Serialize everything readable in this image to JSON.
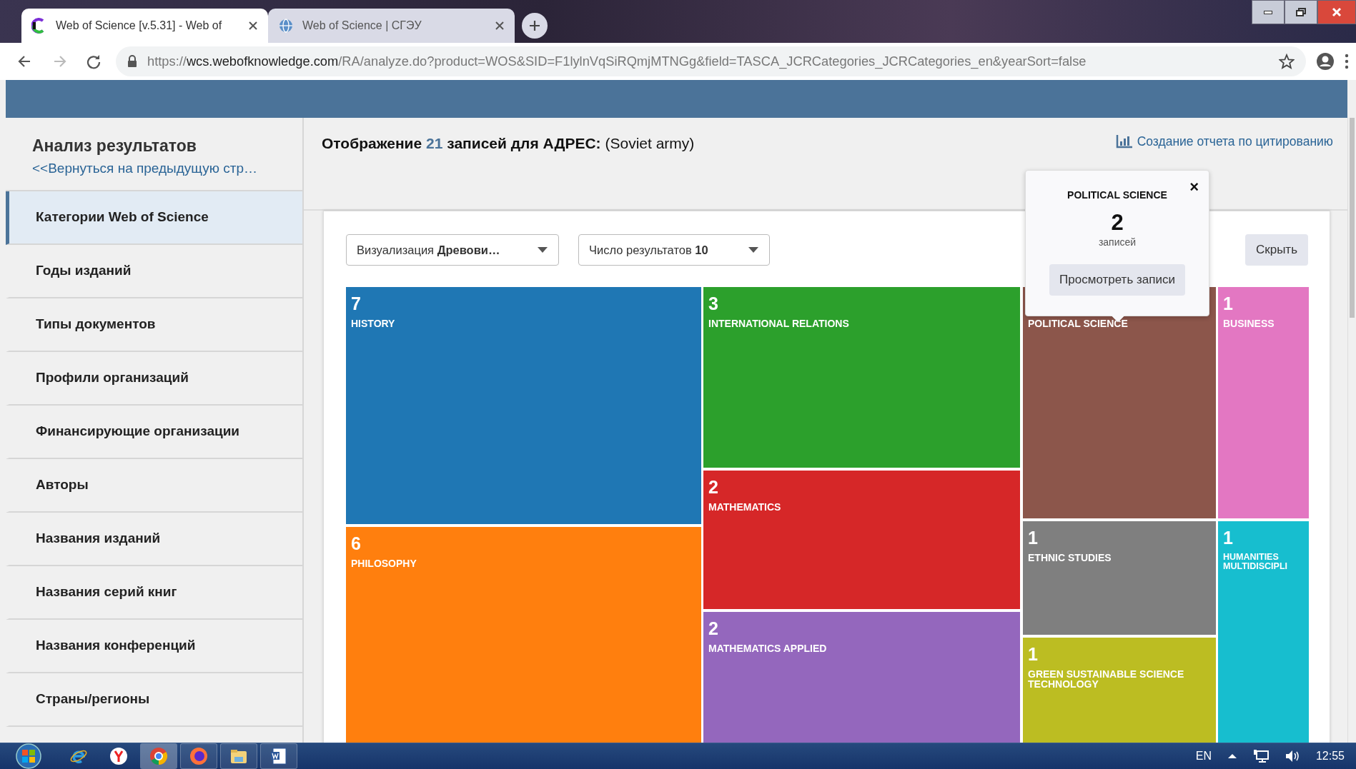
{
  "browser": {
    "tabs": [
      {
        "title": "Web of Science [v.5.31] - Web of",
        "kind": "logo",
        "selected": true
      },
      {
        "title": "Web of Science | СГЭУ",
        "kind": "globe",
        "selected": false
      }
    ],
    "nav": [
      {
        "kind": "back",
        "disabled": false
      },
      {
        "kind": "forward",
        "disabled": true
      },
      {
        "kind": "reload",
        "disabled": false
      }
    ],
    "url": {
      "scheme": "https://",
      "host": "wcs.webofknowledge.com",
      "path": "/RA/analyze.do?product=WOS&SID=F1lylnVqSiRQmjMTNGg&field=TASCA_JCRCategories_JCRCategories_en&yearSort=false"
    }
  },
  "sidebar": {
    "title": "Анализ результатов",
    "back_link": "<<Вернуться на предыдущую стр…",
    "items": [
      {
        "label": "Категории Web of Science",
        "selected": true
      },
      {
        "label": "Годы изданий",
        "selected": false
      },
      {
        "label": "Типы документов",
        "selected": false
      },
      {
        "label": "Профили организаций",
        "selected": false
      },
      {
        "label": "Финансирующие организации",
        "selected": false
      },
      {
        "label": "Авторы",
        "selected": false
      },
      {
        "label": "Названия изданий",
        "selected": false
      },
      {
        "label": "Названия серий книг",
        "selected": false
      },
      {
        "label": "Названия конференций",
        "selected": false
      },
      {
        "label": "Страны/регионы",
        "selected": false
      }
    ]
  },
  "header": {
    "prefix": "Отображение",
    "count": "21",
    "middle": "записей для АДРЕС:",
    "query": "(Soviet army)",
    "report_link": "Создание отчета по цитированию"
  },
  "controls": {
    "visualization": "Визуализация **Древови…**",
    "results": "Число результатов **10**",
    "hide_button": "Скрыть"
  },
  "treemap": {
    "cells": [
      {
        "count": "7",
        "label": "HISTORY",
        "color": "#1f77b4"
      },
      {
        "count": "6",
        "label": "PHILOSOPHY",
        "color": "#ff7f0e"
      },
      {
        "count": "3",
        "label": "INTERNATIONAL RELATIONS",
        "color": "#2ca02c"
      },
      {
        "count": "2",
        "label": "MATHEMATICS",
        "color": "#d62728"
      },
      {
        "count": "2",
        "label": "MATHEMATICS APPLIED",
        "color": "#9467bd"
      },
      {
        "label": "POLITICAL SCIENCE",
        "color": "#8c564b"
      },
      {
        "count": "1",
        "label": "ETHNIC STUDIES",
        "color": "#7f7f7f"
      },
      {
        "count": "1",
        "label": "GREEN SUSTAINABLE SCIENCE TECHNOLOGY",
        "color": "#bcbd22"
      },
      {
        "count": "1",
        "label": "BUSINESS",
        "color": "#e377c2"
      },
      {
        "count": "1",
        "label": "HUMANITIES MULTIDISCIPLI",
        "color": "#17becf"
      }
    ]
  },
  "popup": {
    "title": "POLITICAL SCIENCE",
    "close": "×",
    "count": "2",
    "unit": "записей",
    "button": "Просмотреть записи"
  },
  "taskbar": {
    "apps": [
      {
        "kind": "ie",
        "selected": false
      },
      {
        "kind": "yandex",
        "selected": false
      },
      {
        "kind": "chrome",
        "selected": true
      },
      {
        "kind": "firefox",
        "selected": false
      },
      {
        "kind": "folder",
        "selected": false
      },
      {
        "kind": "word",
        "selected": false
      }
    ],
    "language": "EN",
    "time": "12:55"
  }
}
